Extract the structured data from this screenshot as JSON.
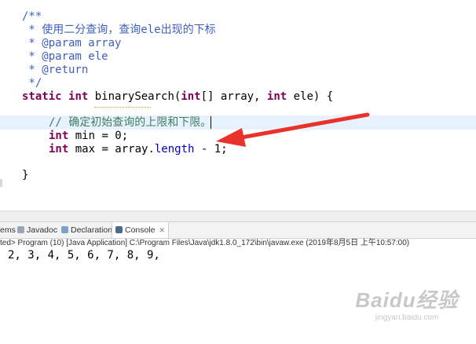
{
  "editor": {
    "lines": {
      "l1": "/**",
      "l2": " * 使用二分查询，查询ele出现的下标",
      "l3": " * @param array",
      "l4": " * @param ele",
      "l5": " * @return",
      "l6": " */",
      "l7_static": "static",
      "l7_int": "int",
      "l7_name": " binarySearch(",
      "l7_int2": "int",
      "l7_mid": "[] array, ",
      "l7_int3": "int",
      "l7_end": " ele) {",
      "l8_comment": "// 确定初始查询的上限和下限。",
      "l9_int": "int",
      "l9_rest": " min = 0;",
      "l10_int": "int",
      "l10_pre": " max = array.",
      "l10_field": "length",
      "l10_post": " - 1;",
      "l11": "}"
    }
  },
  "console_panel": {
    "tabs": {
      "problems": "ems",
      "javadoc": "Javadoc",
      "declaration": "Declaration",
      "console": "Console"
    },
    "status": "ted> Program (10) [Java Application] C:\\Program Files\\Java\\jdk1.8.0_172\\bin\\javaw.exe (2019年8月5日 上午10:57:00)",
    "output": "2, 3, 4, 5, 6, 7, 8, 9,"
  },
  "watermark": {
    "logo": "Baidu经验",
    "url": "jingyan.baidu.com"
  },
  "colors": {
    "arrow": "#e8322a",
    "comment": "#3f5fbf",
    "keyword": "#7f0055"
  }
}
